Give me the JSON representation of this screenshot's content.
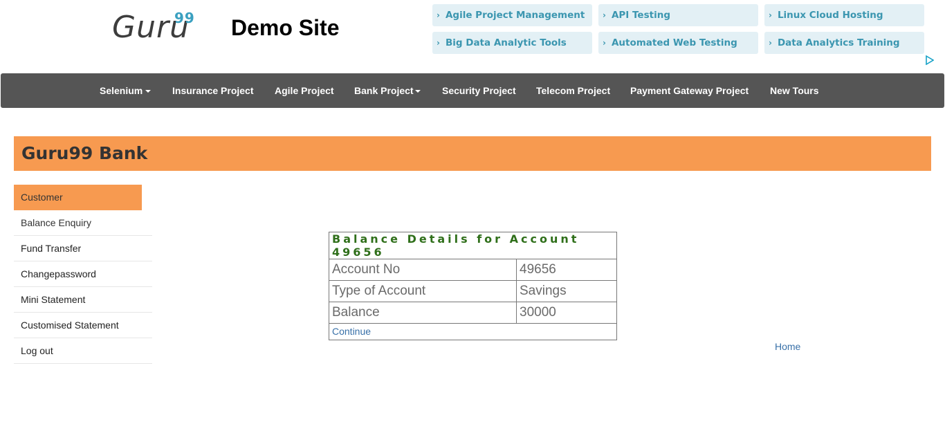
{
  "header": {
    "logo_main": "Guru",
    "logo_sup": "99",
    "site_title": "Demo Site"
  },
  "ads": [
    {
      "label": "Agile Project Management"
    },
    {
      "label": "API Testing"
    },
    {
      "label": "Linux Cloud Hosting"
    },
    {
      "label": "Big Data Analytic Tools"
    },
    {
      "label": "Automated Web Testing"
    },
    {
      "label": "Data Analytics Training"
    }
  ],
  "ad_chevron": "›",
  "nav": {
    "items": [
      {
        "label": "Selenium"
      },
      {
        "label": "Insurance Project"
      },
      {
        "label": "Agile Project"
      },
      {
        "label": "Bank Project"
      },
      {
        "label": "Security Project"
      },
      {
        "label": "Telecom Project"
      },
      {
        "label": "Payment Gateway Project"
      },
      {
        "label": "New Tours"
      }
    ]
  },
  "bank": {
    "title": "Guru99 Bank"
  },
  "sidebar": {
    "items": [
      {
        "label": "Customer"
      },
      {
        "label": "Balance Enquiry"
      },
      {
        "label": "Fund Transfer"
      },
      {
        "label": "Changepassword"
      },
      {
        "label": "Mini Statement"
      },
      {
        "label": "Customised Statement"
      },
      {
        "label": "Log out"
      }
    ]
  },
  "balance": {
    "title": "Balance Details for Account 49656",
    "rows": [
      {
        "label": "Account No",
        "value": "49656"
      },
      {
        "label": "Type of Account",
        "value": "Savings"
      },
      {
        "label": "Balance",
        "value": "30000"
      }
    ],
    "continue_label": "Continue"
  },
  "home_label": "Home",
  "colors": {
    "accent_orange": "#f79a50",
    "nav_bg": "#555555",
    "ad_bg": "#e3f0f5",
    "ad_text": "#3b96b0",
    "title_green": "#2f6f1a",
    "link_blue": "#3870a8"
  }
}
